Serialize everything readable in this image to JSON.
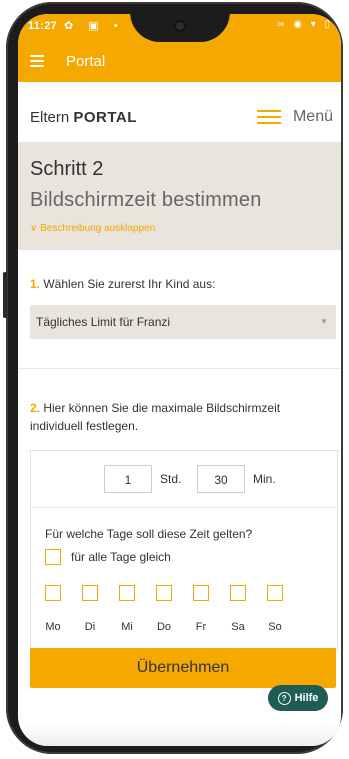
{
  "status_bar": {
    "time": "11:27",
    "left_icons": "✿ ▣ •",
    "right_icons": "∞ ◉ ▾ ▯"
  },
  "appbar": {
    "title": "Portal"
  },
  "header": {
    "brand_light": "Eltern ",
    "brand_bold": "PORTAL",
    "menu_label": "Menü"
  },
  "hero": {
    "step": "Schritt 2",
    "subtitle": "Bildschirmzeit bestimmen",
    "expand_link": "∨ Beschreibung ausklappen"
  },
  "section1": {
    "number": "1.",
    "label": " Wählen Sie zurerst Ihr Kind aus:",
    "select_value": "Tägliches Limit für Franzi",
    "select_arrow": "▼"
  },
  "section2": {
    "number": "2.",
    "label": " Hier können Sie die maximale Bildschirmzeit individuell festlegen."
  },
  "time": {
    "hours_value": "1",
    "hours_unit": "Std.",
    "minutes_value": "30",
    "minutes_unit": "Min."
  },
  "days": {
    "question": "Für welche Tage soll diese Zeit gelten?",
    "same_for_all": "für alle Tage gleich",
    "labels": [
      "Mo",
      "Di",
      "Mi",
      "Do",
      "Fr",
      "Sa",
      "So"
    ]
  },
  "apply_button": "Übernehmen",
  "help_button": {
    "icon": "?",
    "label": "Hilfe"
  },
  "colors": {
    "accent": "#f5a800",
    "beige": "#e9e4dc",
    "help": "#1e5c55"
  }
}
